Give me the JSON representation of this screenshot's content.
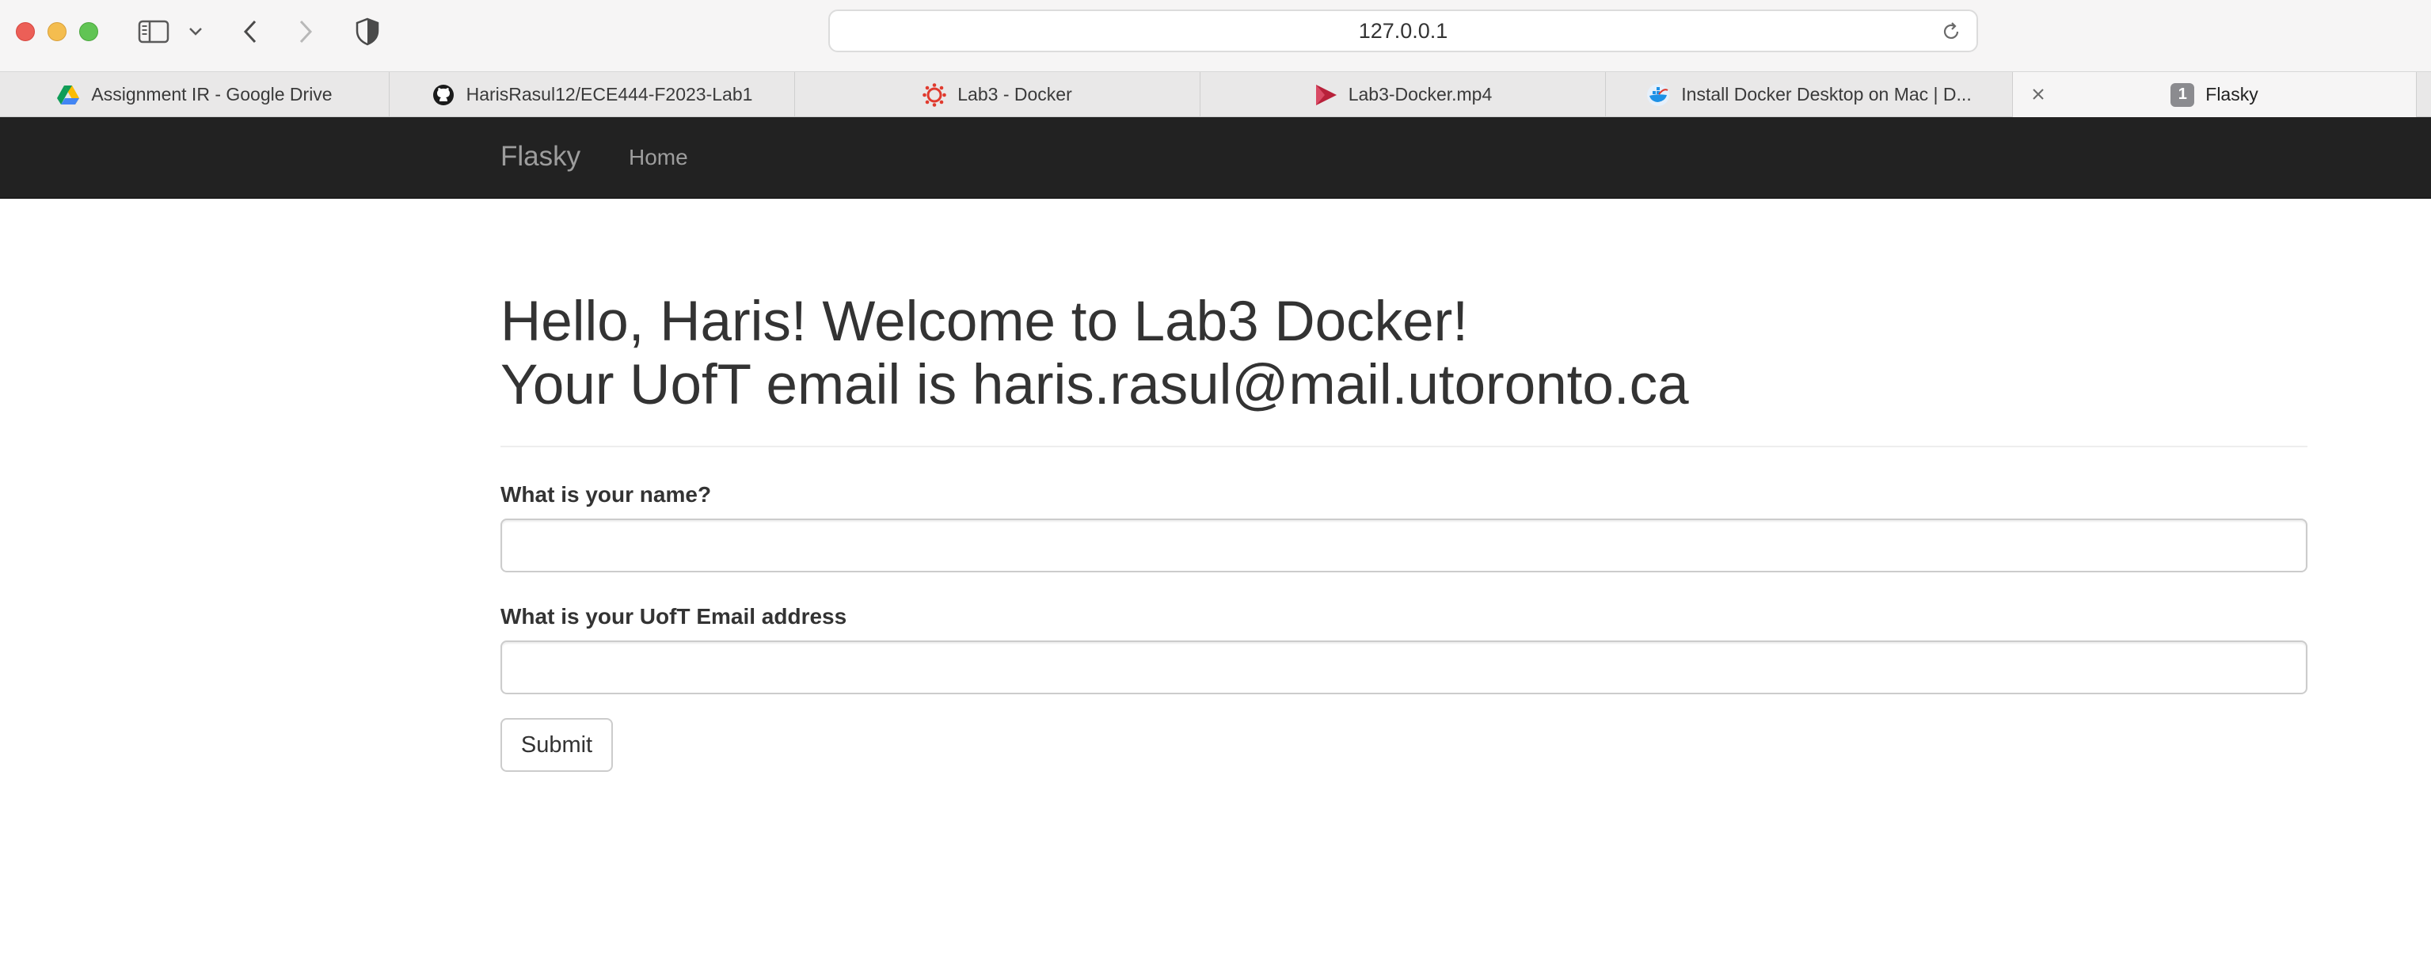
{
  "browser": {
    "url": "127.0.0.1",
    "tabs": [
      {
        "title": "Assignment IR - Google Drive",
        "icon": "google-drive-icon"
      },
      {
        "title": "HarisRasul12/ECE444-F2023-Lab1",
        "icon": "github-icon"
      },
      {
        "title": "Lab3 - Docker",
        "icon": "canvas-lms-icon"
      },
      {
        "title": "Lab3-Docker.mp4",
        "icon": "video-play-icon"
      },
      {
        "title": "Install Docker Desktop on Mac | D...",
        "icon": "docker-icon"
      },
      {
        "title": "Flasky",
        "icon": "tab-number-badge",
        "badge": "1",
        "active": true
      }
    ]
  },
  "navbar": {
    "brand": "Flasky",
    "links": [
      {
        "label": "Home"
      }
    ]
  },
  "main": {
    "greeting_line1": "Hello, Haris! Welcome to Lab3 Docker!",
    "greeting_line2": "Your UofT email is haris.rasul@mail.utoronto.ca",
    "form": {
      "name_label": "What is your name?",
      "name_value": "",
      "email_label": "What is your UofT Email address",
      "email_value": "",
      "submit_label": "Submit"
    }
  },
  "colors": {
    "navbar_bg": "#222222",
    "navbar_text": "#9d9d9d",
    "heading_text": "#333333"
  }
}
